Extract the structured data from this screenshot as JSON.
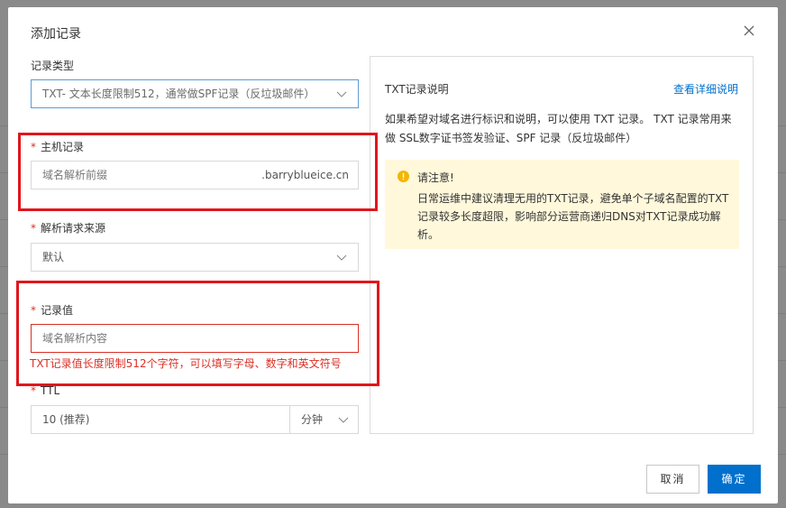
{
  "dialog": {
    "title": "添加记录"
  },
  "form": {
    "record_type": {
      "label": "记录类型",
      "value": "TXT- 文本长度限制512，通常做SPF记录（反垃圾邮件）"
    },
    "host": {
      "label": "主机记录",
      "placeholder": "域名解析前缀",
      "suffix": ".barryblueice.cn"
    },
    "source": {
      "label": "解析请求来源",
      "value": "默认"
    },
    "record_value": {
      "label": "记录值",
      "placeholder": "域名解析内容",
      "error": "TXT记录值长度限制512个字符，可以填写字母、数字和英文符号"
    },
    "ttl": {
      "label": "TTL",
      "value": "10 (推荐)",
      "unit": "分钟"
    }
  },
  "help_panel": {
    "title": "TXT记录说明",
    "link": "查看详细说明",
    "description": "如果希望对域名进行标识和说明，可以使用 TXT 记录。 TXT 记录常用来做 SSL数字证书签发验证、SPF 记录（反垃圾邮件）",
    "notice_title": "请注意!",
    "notice_body": "日常运维中建议清理无用的TXT记录，避免单个子域名配置的TXT记录较多长度超限，影响部分运营商递归DNS对TXT记录成功解析。"
  },
  "footer": {
    "cancel": "取消",
    "confirm": "确定"
  },
  "colors": {
    "primary": "#0070cc",
    "error": "#d93026",
    "annotation_red": "#e0161e",
    "notice_bg": "#fff8db",
    "warning_icon": "#f5b500"
  }
}
